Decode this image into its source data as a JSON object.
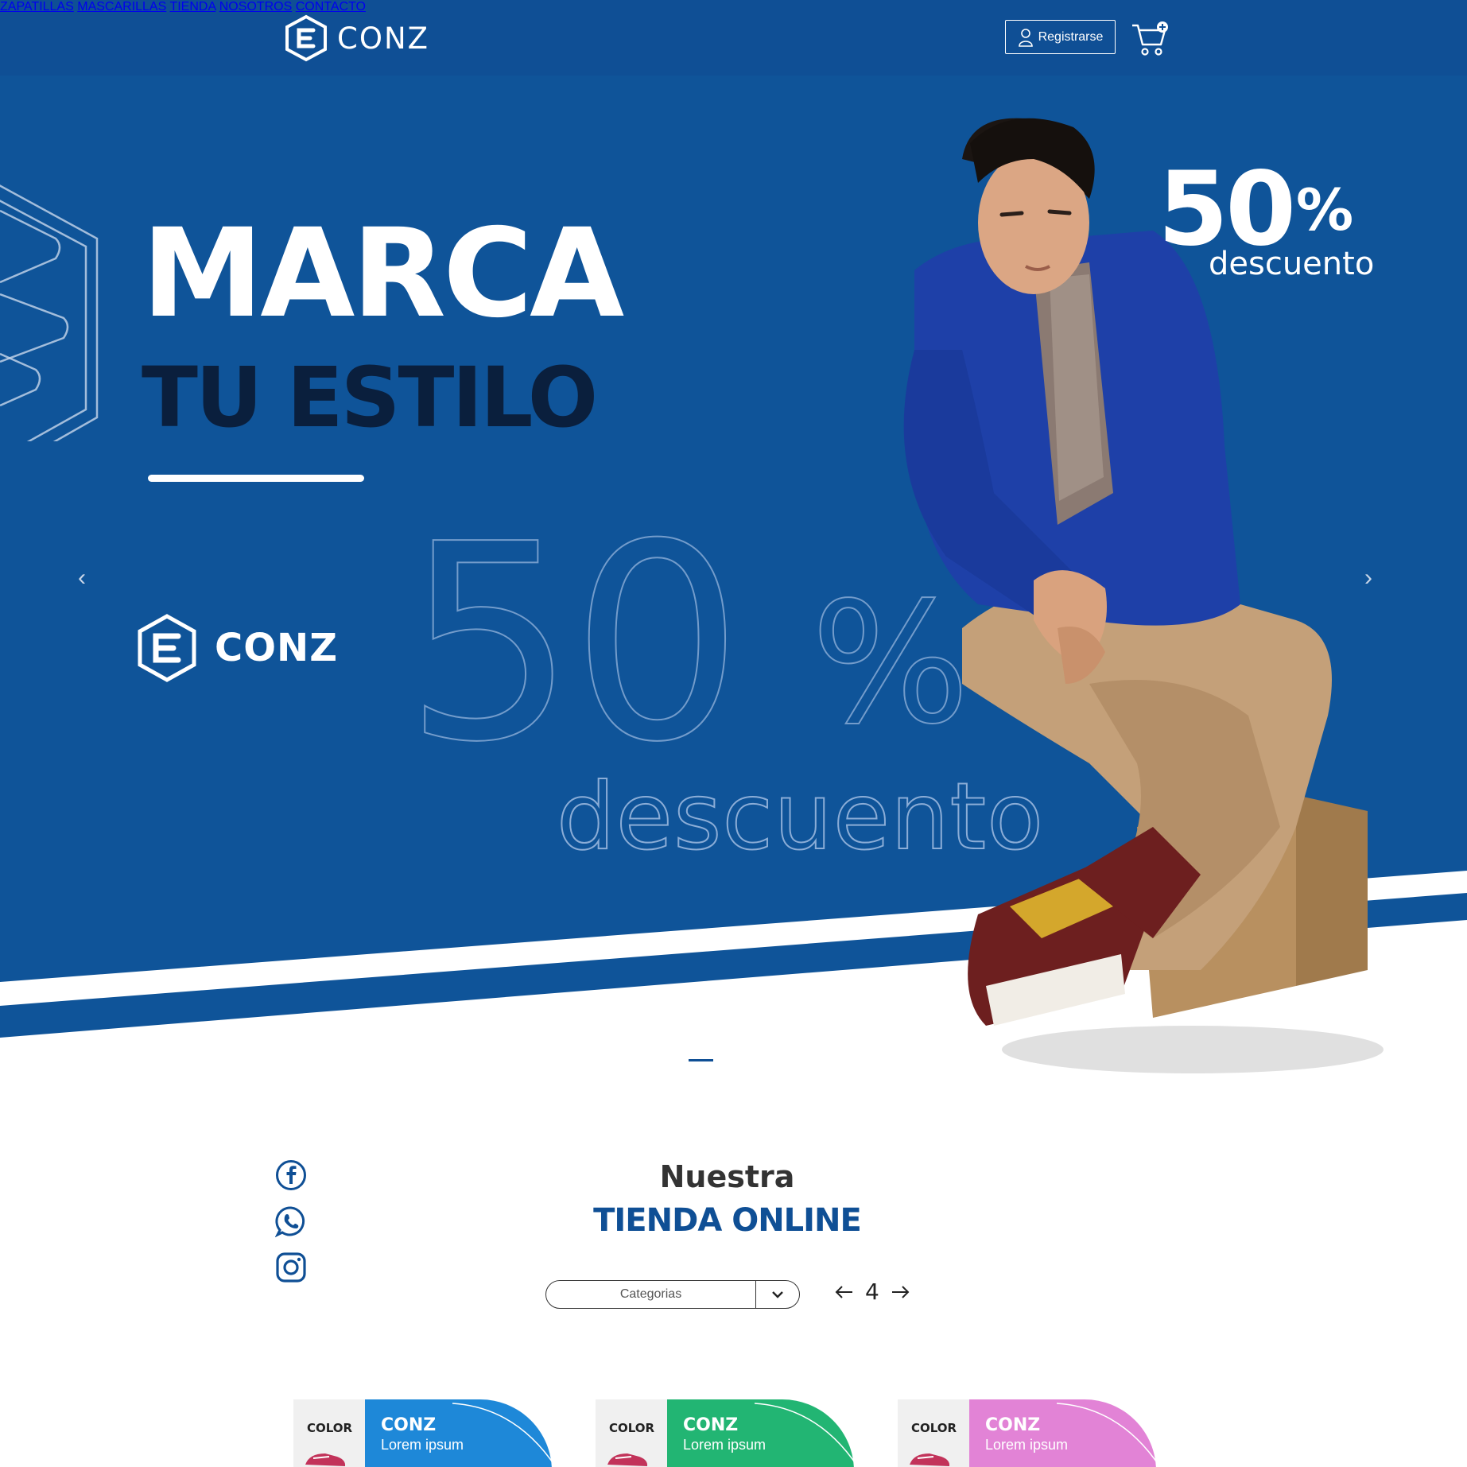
{
  "header": {
    "logo_text": "CONZ",
    "nav": [
      "ZAPATILLAS",
      "MASCARILLAS",
      "TIENDA",
      "NOSOTROS",
      "CONTACTO"
    ],
    "register_label": "Registrarse",
    "icons": [
      "user-icon",
      "cart-icon"
    ]
  },
  "hero": {
    "title_line1": "MARCA",
    "title_line2": "TU ESTILO",
    "logo_text": "CONZ",
    "outline_number": "50",
    "outline_percent": "%",
    "outline_word": "descuento",
    "promo_number": "50",
    "promo_percent": "%",
    "promo_word": "descuento",
    "prev_arrow": "‹",
    "next_arrow": "›"
  },
  "social": [
    "facebook-icon",
    "whatsapp-icon",
    "instagram-icon"
  ],
  "store": {
    "heading_line1": "Nuestra",
    "heading_line2": "TIENDA ONLINE",
    "category_select": "Categorias",
    "page_number": "4"
  },
  "cards": [
    {
      "color_label": "COLOR",
      "brand": "CONZ",
      "text": "Lorem ipsum",
      "accent": "#1e88d8"
    },
    {
      "color_label": "COLOR",
      "brand": "CONZ",
      "text": "Lorem ipsum",
      "accent": "#22b573"
    },
    {
      "color_label": "COLOR",
      "brand": "CONZ",
      "text": "Lorem ipsum",
      "accent": "#e283d6"
    }
  ],
  "colors": {
    "primary": "#0f4f95",
    "hero_blue": "#0f5499",
    "dark_navy": "#0a1f3d"
  }
}
